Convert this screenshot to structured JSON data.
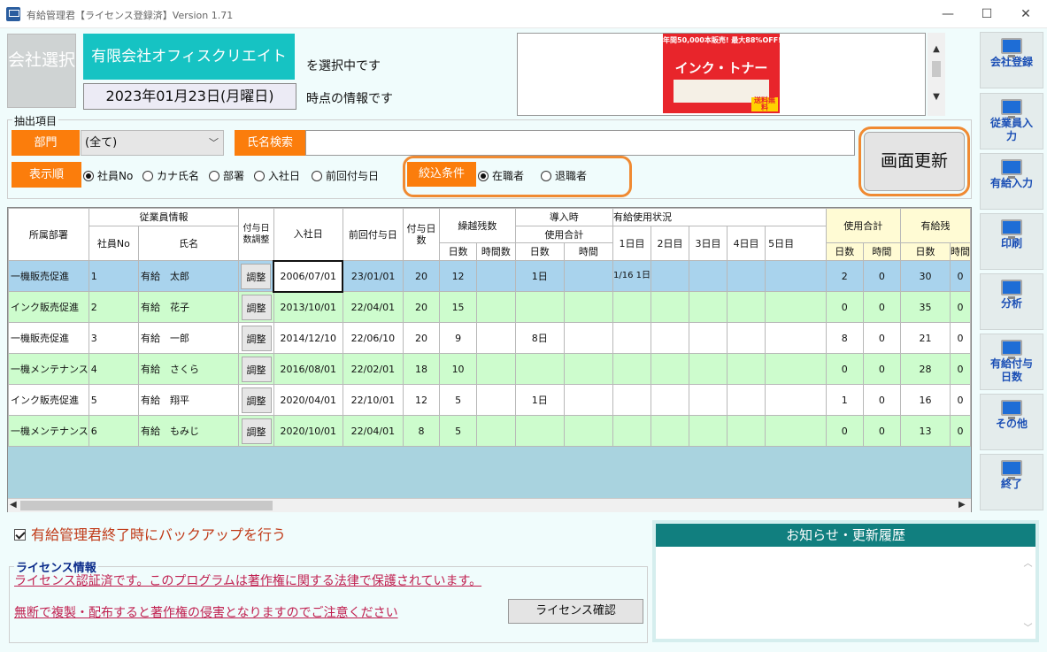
{
  "window": {
    "title": "有給管理君【ライセンス登録済】Version 1.71",
    "minimize": "—",
    "maximize": "☐",
    "close": "✕"
  },
  "header": {
    "company_select_label": "会社選択",
    "company_name": "有限会社オフィスクリエイト",
    "selecting_text": "を選択中です",
    "date": "2023年01月23日(月曜日)",
    "asof_text": "時点の情報です"
  },
  "ad": {
    "top_text": "年間50,000本販売! 最大88%OFF!!",
    "main_text": "インク・トナー",
    "free_text": "送料無料"
  },
  "filters": {
    "legend": "抽出項目",
    "dept_label": "部門",
    "dept_value": "(全て)",
    "name_search_label": "氏名検索",
    "name_search_value": "",
    "order_label": "表示順",
    "order_options": [
      "社員No",
      "カナ氏名",
      "部署",
      "入社日",
      "前回付与日"
    ],
    "order_selected": 0,
    "narrow_label": "絞込条件",
    "narrow_options": [
      "在職者",
      "退職者"
    ],
    "narrow_selected": 0,
    "refresh_label": "画面更新"
  },
  "table": {
    "headers": {
      "dept": "所属部署",
      "employee_info": "従業員情報",
      "emp_no": "社員No",
      "name": "氏名",
      "adjust": "付与日数調整",
      "hire_date": "入社日",
      "last_grant": "前回付与日",
      "grant_days": "付与日数",
      "carry": "繰越残数",
      "carry_days": "日数",
      "carry_hours": "時間数",
      "intro": "導入時",
      "intro_used_total": "使用合計",
      "intro_days": "日数",
      "intro_hours": "時間",
      "usage": "有給使用状況",
      "day1": "1日目",
      "day2": "2日目",
      "day3": "3日目",
      "day4": "4日目",
      "day5": "5日目",
      "used_total": "使用合計",
      "used_days": "日数",
      "used_hours": "時間",
      "remaining": "有給残",
      "rem_days": "日数",
      "rem_hours": "時間"
    },
    "adjust_button": "調整",
    "rows": [
      {
        "dept": "一機販売促進",
        "no": "1",
        "name": "有給　太郎",
        "hire": "2006/07/01",
        "last": "23/01/01",
        "grant": "20",
        "carry_d": "12",
        "carry_h": "",
        "intro_d": "1日",
        "intro_h": "",
        "day1": "1/16 1日",
        "used_d": "2",
        "used_h": "0",
        "rem_d": "30",
        "rem_h": "0"
      },
      {
        "dept": "インク販売促進",
        "no": "2",
        "name": "有給　花子",
        "hire": "2013/10/01",
        "last": "22/04/01",
        "grant": "20",
        "carry_d": "15",
        "carry_h": "",
        "intro_d": "",
        "intro_h": "",
        "day1": "",
        "used_d": "0",
        "used_h": "0",
        "rem_d": "35",
        "rem_h": "0"
      },
      {
        "dept": "一機販売促進",
        "no": "3",
        "name": "有給　一郎",
        "hire": "2014/12/10",
        "last": "22/06/10",
        "grant": "20",
        "carry_d": "9",
        "carry_h": "",
        "intro_d": "8日",
        "intro_h": "",
        "day1": "",
        "used_d": "8",
        "used_h": "0",
        "rem_d": "21",
        "rem_h": "0"
      },
      {
        "dept": "一機メンテナンス",
        "no": "4",
        "name": "有給　さくら",
        "hire": "2016/08/01",
        "last": "22/02/01",
        "grant": "18",
        "carry_d": "10",
        "carry_h": "",
        "intro_d": "",
        "intro_h": "",
        "day1": "",
        "used_d": "0",
        "used_h": "0",
        "rem_d": "28",
        "rem_h": "0"
      },
      {
        "dept": "インク販売促進",
        "no": "5",
        "name": "有給　翔平",
        "hire": "2020/04/01",
        "last": "22/10/01",
        "grant": "12",
        "carry_d": "5",
        "carry_h": "",
        "intro_d": "1日",
        "intro_h": "",
        "day1": "",
        "used_d": "1",
        "used_h": "0",
        "rem_d": "16",
        "rem_h": "0"
      },
      {
        "dept": "一機メンテナンス",
        "no": "6",
        "name": "有給　もみじ",
        "hire": "2020/10/01",
        "last": "22/04/01",
        "grant": "8",
        "carry_d": "5",
        "carry_h": "",
        "intro_d": "",
        "intro_h": "",
        "day1": "",
        "used_d": "0",
        "used_h": "0",
        "rem_d": "13",
        "rem_h": "0"
      }
    ]
  },
  "nav": [
    {
      "label": "会社登録",
      "name": "nav-company-register"
    },
    {
      "label": "従業員入力",
      "name": "nav-employee-input"
    },
    {
      "label": "有給入力",
      "name": "nav-leave-input"
    },
    {
      "label": "印刷",
      "name": "nav-print"
    },
    {
      "label": "分析",
      "name": "nav-analysis"
    },
    {
      "label": "有給付与日数",
      "name": "nav-grant-days"
    },
    {
      "label": "その他",
      "name": "nav-other"
    },
    {
      "label": "終了",
      "name": "nav-exit"
    }
  ],
  "bottom": {
    "backup_label": "有給管理君終了時にバックアップを行う",
    "license_legend": "ライセンス情報",
    "license_line1": "ライセンス認証済です。このプログラムは著作権に関する法律で保護されています。",
    "license_line2": "無断で複製・配布すると著作権の侵害となりますのでご注意ください",
    "license_button": "ライセンス確認",
    "news_title": "お知らせ・更新履歴"
  },
  "colors": {
    "accent_teal": "#16c3c3",
    "orange": "#fb7d0c",
    "nav_text": "#1b4fb5",
    "selected_row": "#a9d3ed",
    "green_row": "#cdfccd"
  }
}
